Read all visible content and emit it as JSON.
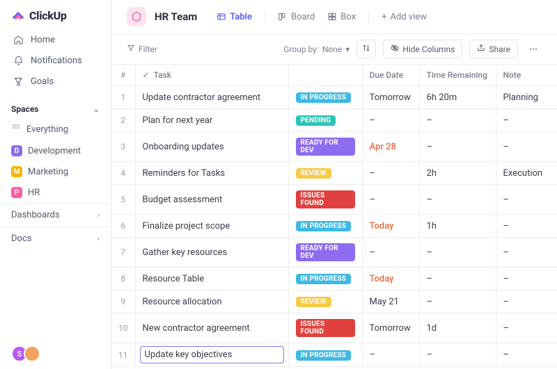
{
  "app": {
    "name": "ClickUp"
  },
  "nav": {
    "home": "Home",
    "notifications": "Notifications",
    "goals": "Goals"
  },
  "spaces": {
    "header": "Spaces",
    "everything": "Everything",
    "items": [
      {
        "label": "Development",
        "initial": "D",
        "color": "#8e6cef"
      },
      {
        "label": "Marketing",
        "initial": "M",
        "color": "#f7b500"
      },
      {
        "label": "HR",
        "initial": "P",
        "color": "#ff5fa2"
      }
    ]
  },
  "collapsibles": {
    "dashboards": "Dashboards",
    "docs": "Docs"
  },
  "header": {
    "team": "HR Team",
    "views": {
      "table": "Table",
      "board": "Board",
      "box": "Box",
      "add": "Add view"
    }
  },
  "toolbar": {
    "filter": "Filter",
    "group_by_label": "Group by:",
    "group_by_value": "None",
    "hide_columns": "Hide Columns",
    "share": "Share"
  },
  "table": {
    "headers": {
      "index": "#",
      "task": "Task",
      "due": "Due Date",
      "remaining": "Time Remaining",
      "note": "Note"
    },
    "rows": [
      {
        "n": "1",
        "task": "Update contractor agreement",
        "status": "IN PROGRESS",
        "status_color": "#3eb9e6",
        "due": "Tomorrow",
        "due_hl": false,
        "remaining": "6h 20m",
        "note": "Planning"
      },
      {
        "n": "2",
        "task": "Plan for next year",
        "status": "PENDING",
        "status_color": "#2ec4b6",
        "due": "–",
        "due_hl": false,
        "remaining": "–",
        "note": "–"
      },
      {
        "n": "3",
        "task": "Onboarding updates",
        "status": "READY FOR DEV",
        "status_color": "#8e6cef",
        "due": "Apr 28",
        "due_hl": true,
        "remaining": "–",
        "note": "–"
      },
      {
        "n": "4",
        "task": "Reminders for Tasks",
        "status": "REVIEW",
        "status_color": "#f7c948",
        "due": "–",
        "due_hl": false,
        "remaining": "2h",
        "note": "Execution"
      },
      {
        "n": "5",
        "task": "Budget assessment",
        "status": "ISSUES FOUND",
        "status_color": "#e0413e",
        "due": "–",
        "due_hl": false,
        "remaining": "–",
        "note": "–"
      },
      {
        "n": "6",
        "task": "Finalize project scope",
        "status": "IN PROGRESS",
        "status_color": "#3eb9e6",
        "due": "Today",
        "due_hl": true,
        "remaining": "1h",
        "note": "–"
      },
      {
        "n": "7",
        "task": "Gather key resources",
        "status": "READY FOR DEV",
        "status_color": "#8e6cef",
        "due": "–",
        "due_hl": false,
        "remaining": "–",
        "note": "–"
      },
      {
        "n": "8",
        "task": "Resource Table",
        "status": "IN PROGRESS",
        "status_color": "#3eb9e6",
        "due": "Today",
        "due_hl": true,
        "remaining": "–",
        "note": "–"
      },
      {
        "n": "9",
        "task": "Resource allocation",
        "status": "REVIEW",
        "status_color": "#f7c948",
        "due": "May 21",
        "due_hl": false,
        "remaining": "–",
        "note": "–"
      },
      {
        "n": "10",
        "task": "New contractor agreement",
        "status": "ISSUES FOUND",
        "status_color": "#e0413e",
        "due": "Tomorrow",
        "due_hl": false,
        "remaining": "1d",
        "note": "–"
      },
      {
        "n": "11",
        "task": "Update key objectives",
        "status": "IN PROGRESS",
        "status_color": "#3eb9e6",
        "due": "–",
        "due_hl": false,
        "remaining": "–",
        "note": "–",
        "editing": true
      }
    ]
  },
  "avatars": [
    {
      "color": "#b557f6",
      "initial": "S"
    },
    {
      "color": "#f2a25c",
      "initial": ""
    }
  ]
}
